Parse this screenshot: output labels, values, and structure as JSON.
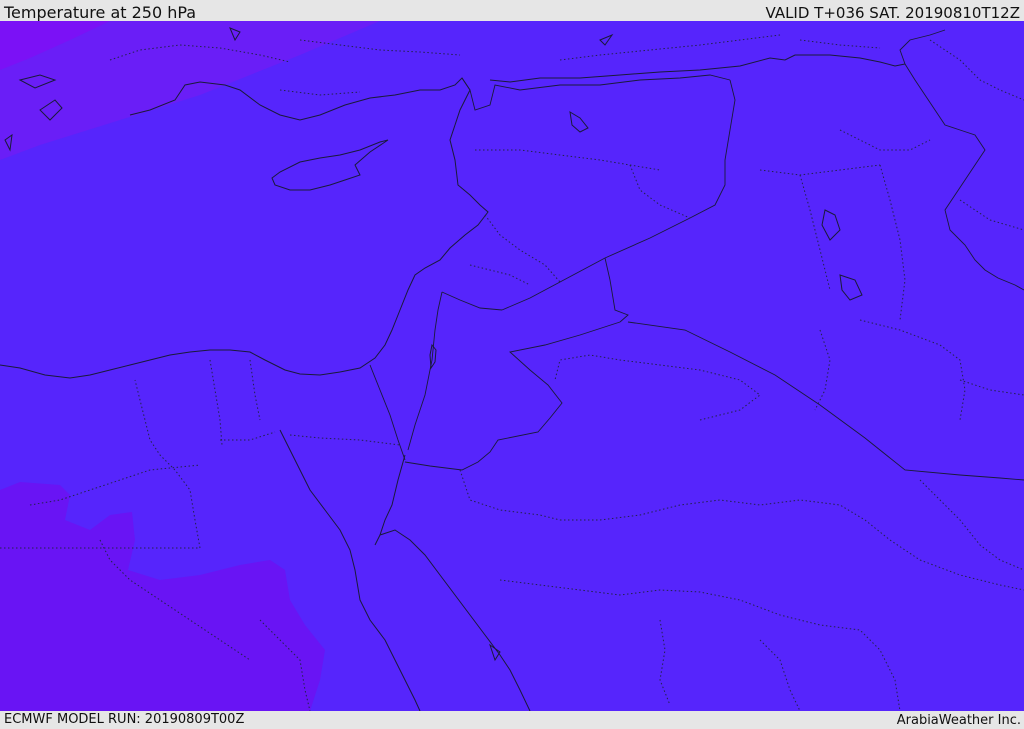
{
  "header": {
    "title": "Temperature at 250 hPa",
    "valid": "VALID T+036 SAT. 20190810T12Z"
  },
  "footer": {
    "model_run": "ECMWF MODEL RUN: 20190809T00Z",
    "credit": "ArabiaWeather Inc."
  },
  "colors": {
    "background_field": "#5625fc",
    "cold_band_nw": "#7b11f6",
    "transition_band": "#6a1ef7",
    "cold_patch_sw": "#6b12f4",
    "lines": "#1a1a3a"
  }
}
